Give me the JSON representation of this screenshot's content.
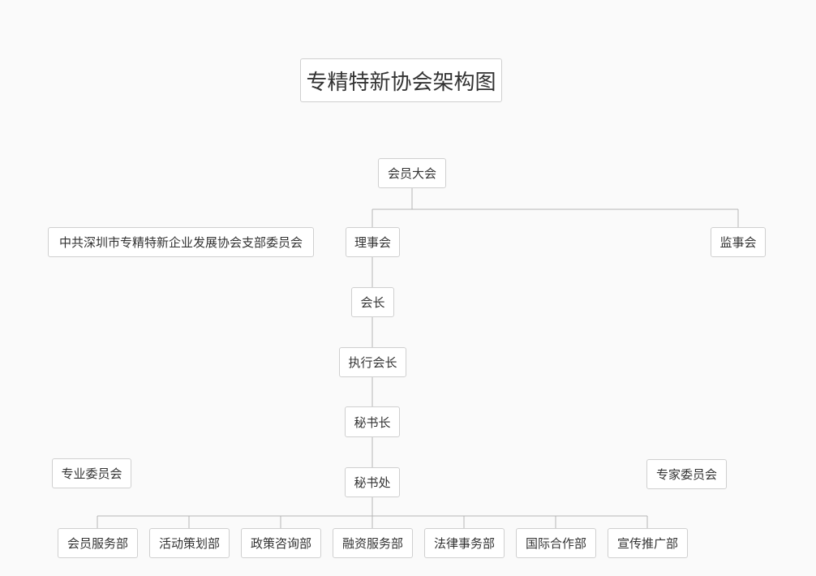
{
  "title": "专精特新协会架构图",
  "colors": {
    "background": "#fafafa",
    "node_border": "#cfcfcf",
    "line": "#b5b5b5",
    "text": "#333333"
  },
  "nodes": {
    "general_assembly": "会员大会",
    "party_branch": "中共深圳市专精特新企业发展协会支部委员会",
    "council": "理事会",
    "supervisory_board": "监事会",
    "president": "会长",
    "executive_president": "执行会长",
    "secretary_general": "秘书长",
    "secretariat": "秘书处",
    "professional_committee": "专业委员会",
    "expert_committee": "专家委员会"
  },
  "departments": [
    "会员服务部",
    "活动策划部",
    "政策咨询部",
    "融资服务部",
    "法律事务部",
    "国际合作部",
    "宣传推广部"
  ]
}
